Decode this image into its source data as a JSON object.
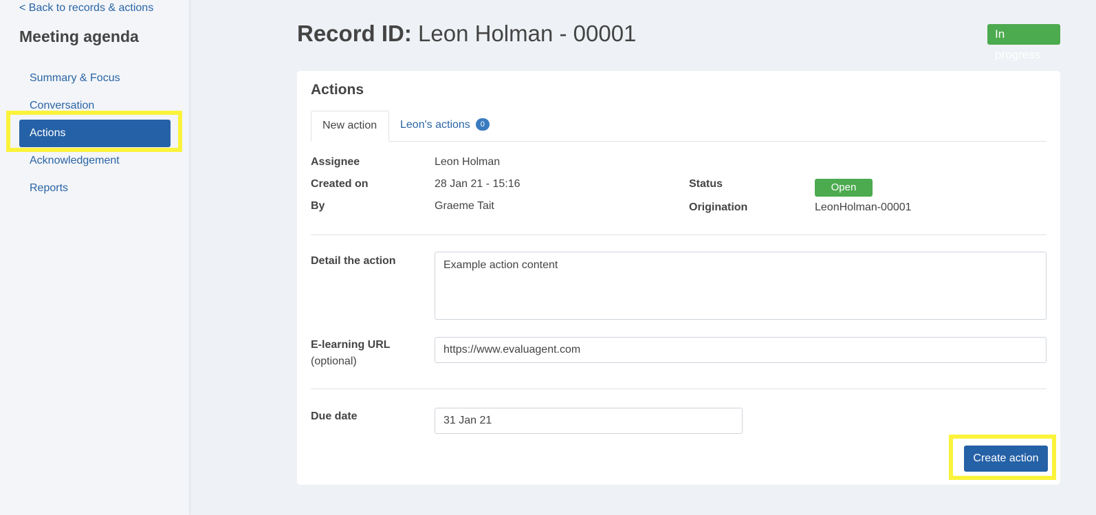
{
  "sidebar": {
    "back_link": "< Back to records & actions",
    "title": "Meeting agenda",
    "items": [
      {
        "label": "Summary & Focus"
      },
      {
        "label": "Conversation"
      },
      {
        "label": "Actions"
      },
      {
        "label": "Acknowledgement"
      },
      {
        "label": "Reports"
      }
    ]
  },
  "header": {
    "record_prefix": "Record ID:",
    "record_name": "Leon Holman - 00001",
    "status": "In progress"
  },
  "card": {
    "title": "Actions",
    "tabs": [
      {
        "label": "New action"
      },
      {
        "label": "Leon's actions",
        "count": "0"
      }
    ],
    "meta": {
      "assignee_label": "Assignee",
      "assignee": "Leon Holman",
      "created_label": "Created on",
      "created": "28 Jan 21 - 15:16",
      "by_label": "By",
      "by": "Graeme Tait",
      "status_label": "Status",
      "status": "Open",
      "origination_label": "Origination",
      "origination": "LeonHolman-00001"
    },
    "form": {
      "detail_label": "Detail the action",
      "detail_value": "Example action content",
      "url_label": "E-learning URL",
      "url_sub": "(optional)",
      "url_value": "https://www.evaluagent.com",
      "due_label": "Due date",
      "due_value": "31 Jan 21",
      "create_button": "Create action"
    }
  },
  "colors": {
    "primary": "#2561a6",
    "success": "#4caa4f",
    "highlight": "#fbf33b",
    "link": "#2a64a5"
  }
}
